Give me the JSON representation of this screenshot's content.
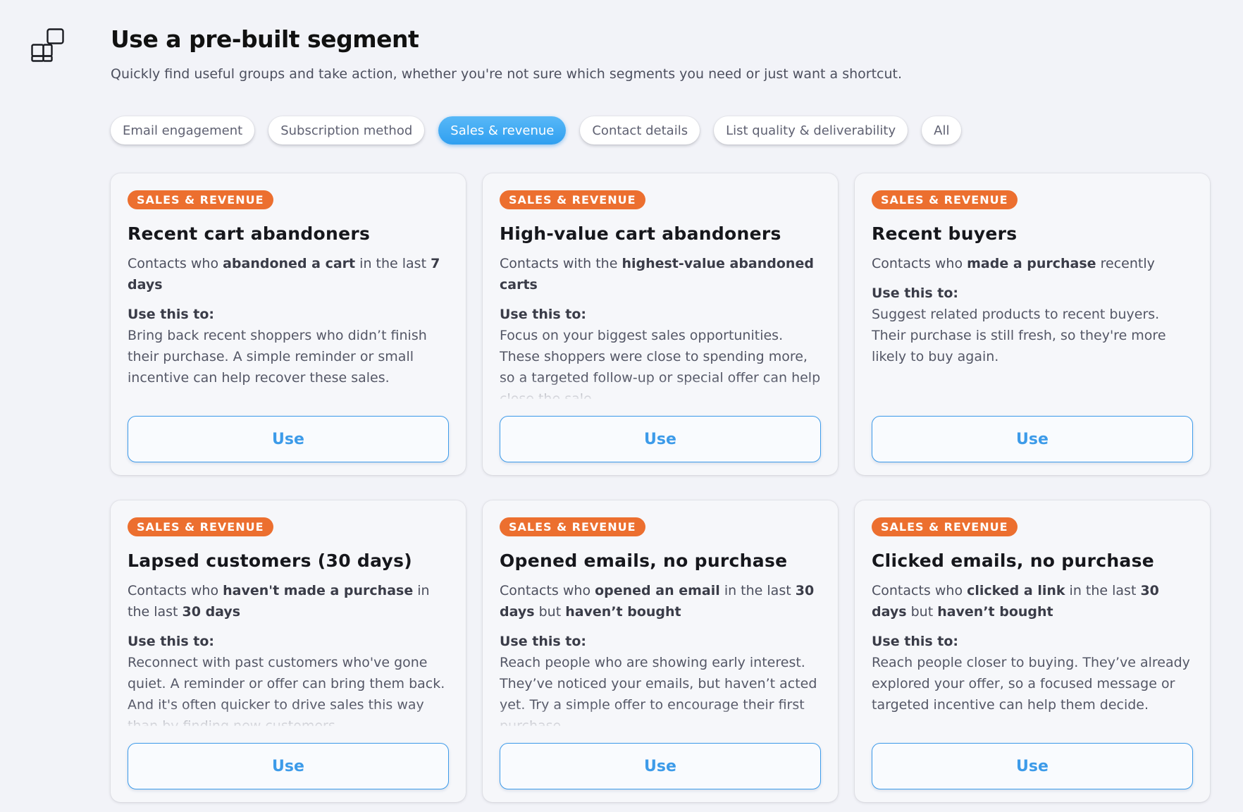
{
  "header": {
    "icon": "segment-blocks-icon",
    "title": "Use a pre-built segment",
    "subtitle": "Quickly find useful groups and take action, whether you're not sure which segments you need or just want a shortcut."
  },
  "tabs": [
    {
      "label": "Email engagement",
      "active": false
    },
    {
      "label": "Subscription method",
      "active": false
    },
    {
      "label": "Sales & revenue",
      "active": true
    },
    {
      "label": "Contact details",
      "active": false
    },
    {
      "label": "List quality & deliverability",
      "active": false
    },
    {
      "label": "All",
      "active": false
    }
  ],
  "colors": {
    "accent": "#3d9be9",
    "active_tab": "#3aa6f2",
    "badge": "#ec6f2f",
    "background": "#f2f3f8"
  },
  "cards": [
    {
      "badge": "SALES & REVENUE",
      "title": "Recent cart abandoners",
      "desc": [
        {
          "t": "Contacts who ",
          "b": false
        },
        {
          "t": "abandoned a cart",
          "b": true
        },
        {
          "t": " in the last ",
          "b": false
        },
        {
          "t": "7 days",
          "b": true
        }
      ],
      "use_heading": "Use this to:",
      "use_text": "Bring back recent shoppers who didn’t finish their purchase. A simple reminder or small incentive can help recover these sales.",
      "truncated": false,
      "button": "Use"
    },
    {
      "badge": "SALES & REVENUE",
      "title": "High-value cart abandoners",
      "desc": [
        {
          "t": "Contacts with the ",
          "b": false
        },
        {
          "t": "highest-value abandoned carts",
          "b": true
        }
      ],
      "use_heading": "Use this to:",
      "use_text": "Focus on your biggest sales opportunities. These shoppers were close to spending more, so a targeted follow-up or special offer can help close the sale.",
      "truncated": true,
      "button": "Use"
    },
    {
      "badge": "SALES & REVENUE",
      "title": "Recent buyers",
      "desc": [
        {
          "t": "Contacts who ",
          "b": false
        },
        {
          "t": "made a purchase",
          "b": true
        },
        {
          "t": " recently",
          "b": false
        }
      ],
      "use_heading": "Use this to:",
      "use_text": "Suggest related products to recent buyers. Their purchase is still fresh, so they're more likely to buy again.",
      "truncated": false,
      "button": "Use"
    },
    {
      "badge": "SALES & REVENUE",
      "title": "Lapsed customers (30 days)",
      "desc": [
        {
          "t": "Contacts who ",
          "b": false
        },
        {
          "t": "haven't made a purchase",
          "b": true
        },
        {
          "t": " in the last ",
          "b": false
        },
        {
          "t": "30 days",
          "b": true
        }
      ],
      "use_heading": "Use this to:",
      "use_text": "Reconnect with past customers who've gone quiet. A reminder or offer can bring them back. And it's often quicker to drive sales this way than by finding new customers.",
      "truncated": true,
      "button": "Use"
    },
    {
      "badge": "SALES & REVENUE",
      "title": "Opened emails, no purchase",
      "desc": [
        {
          "t": "Contacts who ",
          "b": false
        },
        {
          "t": "opened an email",
          "b": true
        },
        {
          "t": " in the last ",
          "b": false
        },
        {
          "t": "30 days",
          "b": true
        },
        {
          "t": " but ",
          "b": false
        },
        {
          "t": "haven’t bought",
          "b": true
        }
      ],
      "use_heading": "Use this to:",
      "use_text": "Reach people who are showing early interest. They’ve noticed your emails, but haven’t acted yet. Try a simple offer to encourage their first purchase.",
      "truncated": true,
      "button": "Use"
    },
    {
      "badge": "SALES & REVENUE",
      "title": "Clicked emails, no purchase",
      "desc": [
        {
          "t": "Contacts who ",
          "b": false
        },
        {
          "t": "clicked a link",
          "b": true
        },
        {
          "t": " in the last ",
          "b": false
        },
        {
          "t": "30 days",
          "b": true
        },
        {
          "t": " but ",
          "b": false
        },
        {
          "t": "haven’t bought",
          "b": true
        }
      ],
      "use_heading": "Use this to:",
      "use_text": "Reach people closer to buying. They’ve already explored your offer, so a focused message or targeted incentive can help them decide.",
      "truncated": false,
      "button": "Use"
    }
  ]
}
